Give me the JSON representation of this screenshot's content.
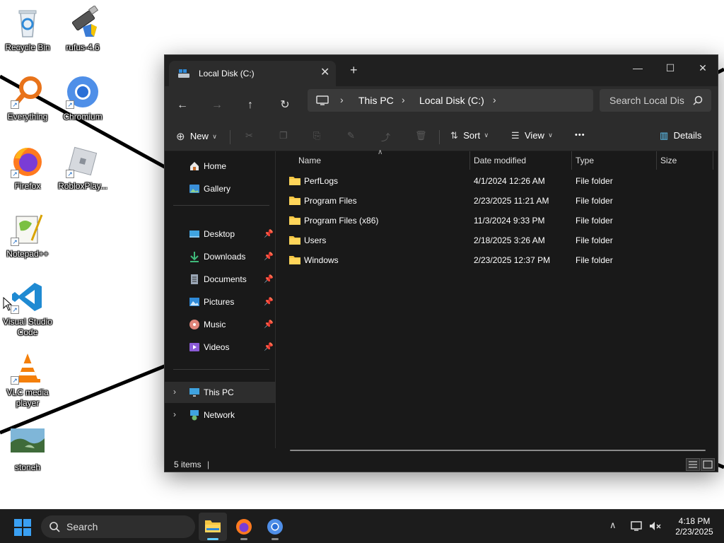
{
  "desktop": {
    "icons": [
      {
        "label": "Recycle Bin",
        "icon": "recycle-bin-icon"
      },
      {
        "label": "rufus-4.6",
        "icon": "usb-drive-icon"
      },
      {
        "label": "Everything",
        "icon": "magnifier-icon"
      },
      {
        "label": "Chromium",
        "icon": "chromium-icon"
      },
      {
        "label": "Firefox",
        "icon": "firefox-icon"
      },
      {
        "label": "RobloxPlay...",
        "icon": "roblox-icon"
      },
      {
        "label": "Notepad++",
        "icon": "notepad-plus-plus-icon"
      },
      {
        "label": "Visual Studio Code",
        "icon": "vscode-icon"
      },
      {
        "label": "VLC media player",
        "icon": "vlc-cone-icon"
      },
      {
        "label": "stoneh",
        "icon": "image-thumbnail-icon"
      }
    ]
  },
  "window": {
    "tab_title": "Local Disk (C:)",
    "breadcrumb": [
      "This PC",
      "Local Disk (C:)"
    ],
    "search_placeholder": "Search Local Dis",
    "toolbar": {
      "new_label": "New",
      "sort_label": "Sort",
      "view_label": "View",
      "more_label": "•••",
      "details_label": "Details"
    },
    "nav": {
      "home": "Home",
      "gallery": "Gallery",
      "desktop": "Desktop",
      "downloads": "Downloads",
      "documents": "Documents",
      "pictures": "Pictures",
      "music": "Music",
      "videos": "Videos",
      "this_pc": "This PC",
      "network": "Network"
    },
    "columns": [
      "Name",
      "Date modified",
      "Type",
      "Size"
    ],
    "rows": [
      {
        "name": "PerfLogs",
        "date": "4/1/2024 12:26 AM",
        "type": "File folder",
        "size": ""
      },
      {
        "name": "Program Files",
        "date": "2/23/2025 11:21 AM",
        "type": "File folder",
        "size": ""
      },
      {
        "name": "Program Files (x86)",
        "date": "11/3/2024 9:33 PM",
        "type": "File folder",
        "size": ""
      },
      {
        "name": "Users",
        "date": "2/18/2025 3:26 AM",
        "type": "File folder",
        "size": ""
      },
      {
        "name": "Windows",
        "date": "2/23/2025 12:37 PM",
        "type": "File folder",
        "size": ""
      }
    ],
    "status": "5 items"
  },
  "taskbar": {
    "search_label": "Search",
    "time": "4:18 PM",
    "date": "2/23/2025"
  },
  "colors": {
    "folder": "#f4c542",
    "accent": "#60cdff",
    "window_bg": "#191919",
    "chrome_bg": "#2c2c2c"
  }
}
